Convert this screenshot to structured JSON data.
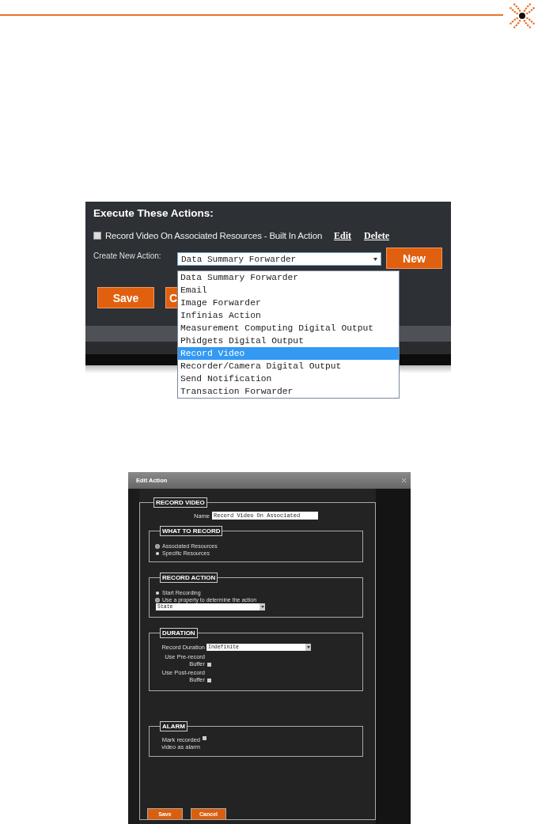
{
  "actions_panel": {
    "title": "Execute These Actions:",
    "existing_actions": [
      {
        "label": "Record Video On Associated Resources - Built In Action",
        "checked": false,
        "links": [
          "Edit",
          "Delete"
        ]
      }
    ],
    "create_label": "Create New Action:",
    "select_value": "Data Summary Forwarder",
    "new_button": "New",
    "options": [
      {
        "label": "Data Summary Forwarder",
        "selected": false
      },
      {
        "label": "Email",
        "selected": false
      },
      {
        "label": "Image Forwarder",
        "selected": false
      },
      {
        "label": "Infinias Action",
        "selected": false
      },
      {
        "label": "Measurement Computing Digital Output",
        "selected": false
      },
      {
        "label": "Phidgets Digital Output",
        "selected": false
      },
      {
        "label": "Record Video",
        "selected": true
      },
      {
        "label": "Recorder/Camera Digital Output",
        "selected": false
      },
      {
        "label": "Send Notification",
        "selected": false
      },
      {
        "label": "Transaction Forwarder",
        "selected": false
      }
    ],
    "buttons": [
      "Save",
      "C"
    ]
  },
  "edit_dialog": {
    "title": "Edit Action",
    "legend": "RECORD VIDEO",
    "name_label": "Name",
    "name_value": "Record Video On Associated",
    "sections": [
      {
        "legend": "WHAT TO RECORD",
        "kind": "radios",
        "options": [
          {
            "label": "Associated Resources",
            "selected": true
          },
          {
            "label": "Specific Resources",
            "selected": false
          }
        ]
      },
      {
        "legend": "RECORD ACTION",
        "kind": "radios",
        "options": [
          {
            "label": "Start Recording",
            "selected": false
          },
          {
            "label": "Use a property to determine the action",
            "selected": true
          }
        ],
        "select_value": "State"
      },
      {
        "legend": "DURATION",
        "kind": "fields",
        "select_label": "Record Duration",
        "select_value": "Indefinite",
        "checkboxes": [
          {
            "label": "Use Pre-record Buffer",
            "checked": false
          },
          {
            "label": "Use Post-record Buffer",
            "checked": false
          }
        ]
      },
      {
        "legend": "ALARM",
        "kind": "fields",
        "checkboxes": [
          {
            "label": "Mark recorded video as alarm",
            "checked": false
          }
        ]
      }
    ],
    "buttons": [
      "Save",
      "Cancel"
    ]
  }
}
